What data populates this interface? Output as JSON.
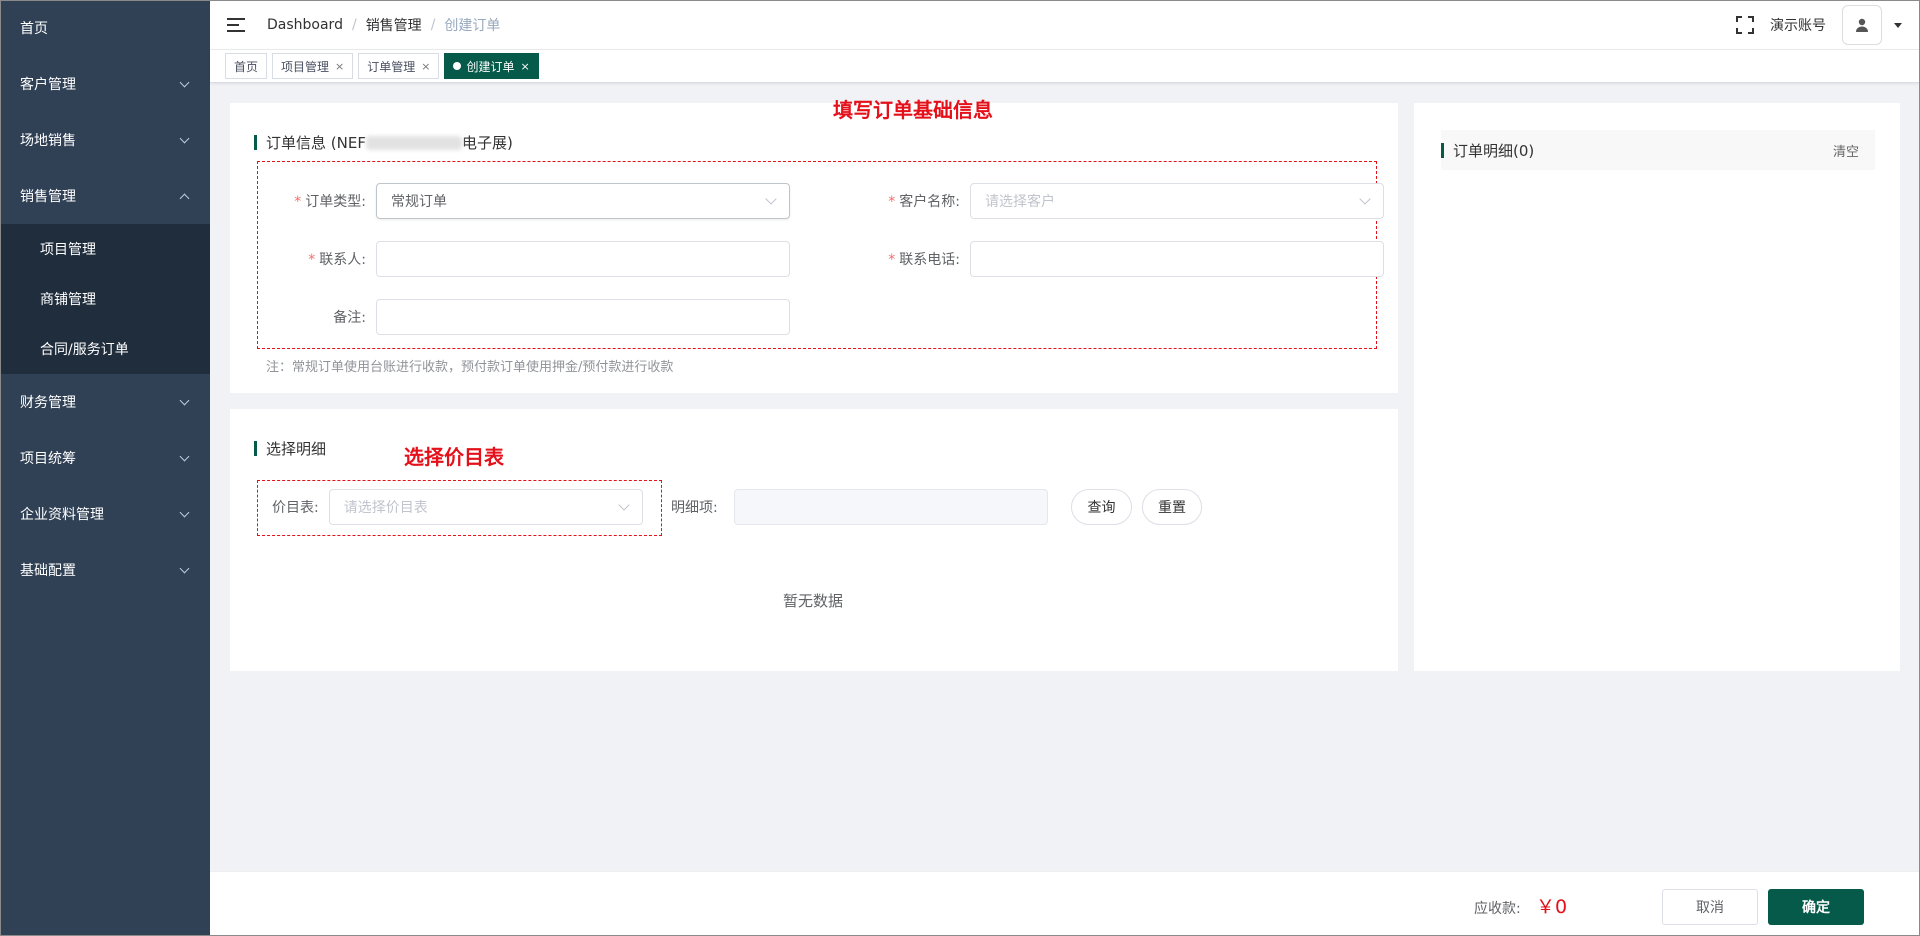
{
  "sidebar": {
    "items": [
      {
        "label": "首页"
      },
      {
        "label": "客户管理"
      },
      {
        "label": "场地销售"
      },
      {
        "label": "销售管理"
      },
      {
        "label": "财务管理"
      },
      {
        "label": "项目统筹"
      },
      {
        "label": "企业资料管理"
      },
      {
        "label": "基础配置"
      }
    ],
    "submenu": [
      {
        "label": "项目管理"
      },
      {
        "label": "商铺管理"
      },
      {
        "label": "合同/服务订单"
      }
    ]
  },
  "header": {
    "breadcrumb": [
      "Dashboard",
      "销售管理",
      "创建订单"
    ],
    "user_name": "演示账号"
  },
  "tags": [
    {
      "label": "首页"
    },
    {
      "label": "项目管理"
    },
    {
      "label": "订单管理"
    },
    {
      "label": "创建订单"
    }
  ],
  "order_info": {
    "title_prefix": "订单信息 (NEF",
    "title_suffix": "电子展)",
    "annotation": "填写订单基础信息",
    "order_type_label": "订单类型:",
    "order_type_value": "常规订单",
    "customer_label": "客户名称:",
    "customer_placeholder": "请选择客户",
    "contact_label": "联系人:",
    "phone_label": "联系电话:",
    "remark_label": "备注:",
    "note": "注：常规订单使用台账进行收款，预付款订单使用押金/预付款进行收款"
  },
  "select_detail": {
    "title": "选择明细",
    "annotation": "选择价目表",
    "price_label": "价目表:",
    "price_placeholder": "请选择价目表",
    "item_label": "明细项:",
    "query_button": "查询",
    "reset_button": "重置",
    "empty_text": "暂无数据"
  },
  "order_detail": {
    "title": "订单明细(0)",
    "clear_label": "清空"
  },
  "footer": {
    "amount_label": "应收款:",
    "amount_value": "￥0",
    "cancel_button": "取消",
    "confirm_button": "确定"
  },
  "colors": {
    "accent": "#055a4a",
    "sidebar_bg": "#304156",
    "submenu_bg": "#1f2d3d",
    "annotation": "#e4101a"
  }
}
